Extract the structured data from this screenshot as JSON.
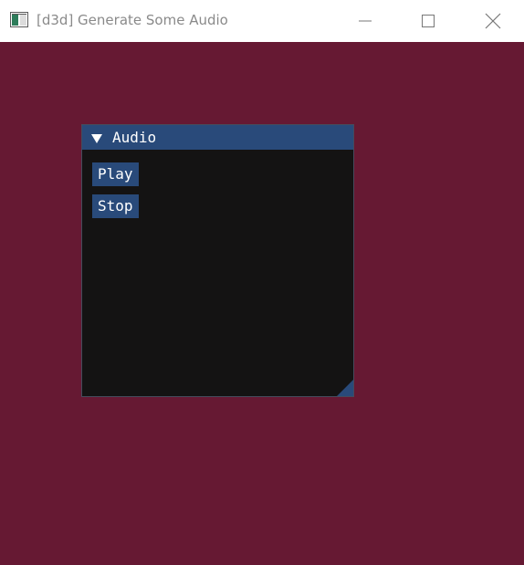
{
  "window": {
    "title": "[d3d] Generate Some Audio",
    "icons": {
      "app": "app-icon",
      "minimize": "minimize-icon",
      "maximize": "maximize-icon",
      "close": "close-icon"
    }
  },
  "colors": {
    "client_background": "#661933",
    "imgui_title_bar": "#294a7a",
    "imgui_window_bg": "#141313",
    "button_bg": "#294a7a",
    "text": "#ffffff"
  },
  "imgui_window": {
    "title": "Audio",
    "collapse_icon": "triangle-down-icon",
    "buttons": [
      {
        "label": "Play"
      },
      {
        "label": "Stop"
      }
    ],
    "resize_grip_icon": "resize-grip-icon"
  }
}
